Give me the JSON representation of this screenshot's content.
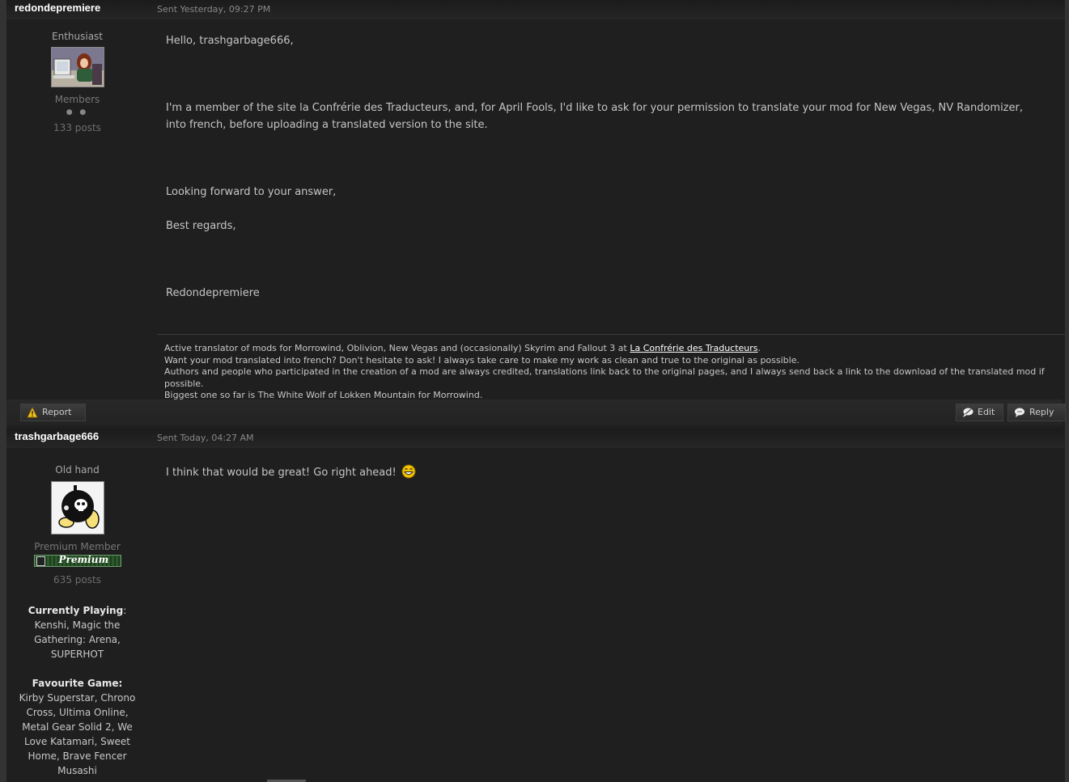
{
  "posts": [
    {
      "author": "redondepremiere",
      "sent": "Sent Yesterday, 09:27 PM",
      "rank": "Enthusiast",
      "group": "Members",
      "pips": "● ●",
      "post_count": "133 posts",
      "body": {
        "greeting": "Hello, trashgarbage666,",
        "paragraph": "I'm a member of the site la Confrérie des Traducteurs, and, for April Fools, I'd like to ask for your permission to translate your mod for New Vegas, NV Randomizer, into french, before uploading a translated version to the site.",
        "looking_forward": "Looking forward to your answer,",
        "regards": "Best regards,",
        "signoff": "Redondepremiere"
      },
      "signature": {
        "line1_prefix": "Active translator of mods for Morrowind, Oblivion, New Vegas and (occasionally) Skyrim and Fallout 3 at ",
        "line1_link": "La Confrérie des Traducteurs",
        "line1_suffix": ".",
        "line2": "Want your mod translated into french? Don't hesitate to ask! I always take care to make my work as clean and true to the original as possible.",
        "line3": "Authors and people who participated in the creation of a mod are always credited, translations link back to the original pages, and I always send back a link to the download of the translated mod if possible.",
        "line4": "Biggest one so far is The White Wolf of Lokken Mountain for Morrowind."
      }
    },
    {
      "author": "trashgarbage666",
      "sent": "Sent Today, 04:27 AM",
      "rank": "Old hand",
      "group": "Premium Member",
      "badge_text": "Premium",
      "post_count": "635 posts",
      "currently_playing_label": "Currently Playing",
      "currently_playing": "Kenshi, Magic the Gathering: Arena, SUPERHOT",
      "favourite_game_label": "Favourite Game",
      "favourite_game": "Kirby Superstar, Chrono Cross, Ultima Online, Metal Gear Solid 2, We Love Katamari, Sweet Home, Brave Fencer Musashi",
      "body": "I think that would be great! Go right ahead!"
    }
  ],
  "actions": {
    "report": "Report",
    "edit": "Edit",
    "reply": "Reply"
  }
}
